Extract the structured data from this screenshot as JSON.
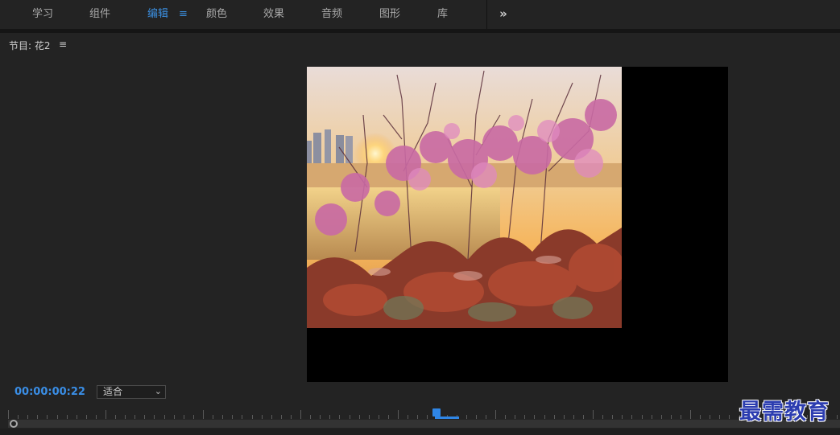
{
  "workspace": {
    "tabs": [
      {
        "label": "学习"
      },
      {
        "label": "组件"
      },
      {
        "label": "编辑"
      },
      {
        "label": "颜色"
      },
      {
        "label": "效果"
      },
      {
        "label": "音频"
      },
      {
        "label": "图形"
      },
      {
        "label": "库"
      }
    ],
    "active_tab": "编辑",
    "menu_glyph": "≡",
    "overflow_glyph": "»"
  },
  "program_panel": {
    "title": "节目: 花2",
    "menu_glyph": "≡"
  },
  "monitor": {
    "image_subject": "pink blossoms and red leaves at sunset"
  },
  "controls": {
    "timecode": "00:00:00:22",
    "zoom_value": "适合",
    "zoom_chevron": "⌄"
  },
  "timeline": {
    "playhead_fraction": 0.52
  },
  "watermark": {
    "text": "最需教育"
  },
  "colors": {
    "accent": "#3b8fe0",
    "background": "#232323",
    "monitor_background": "#000000"
  }
}
